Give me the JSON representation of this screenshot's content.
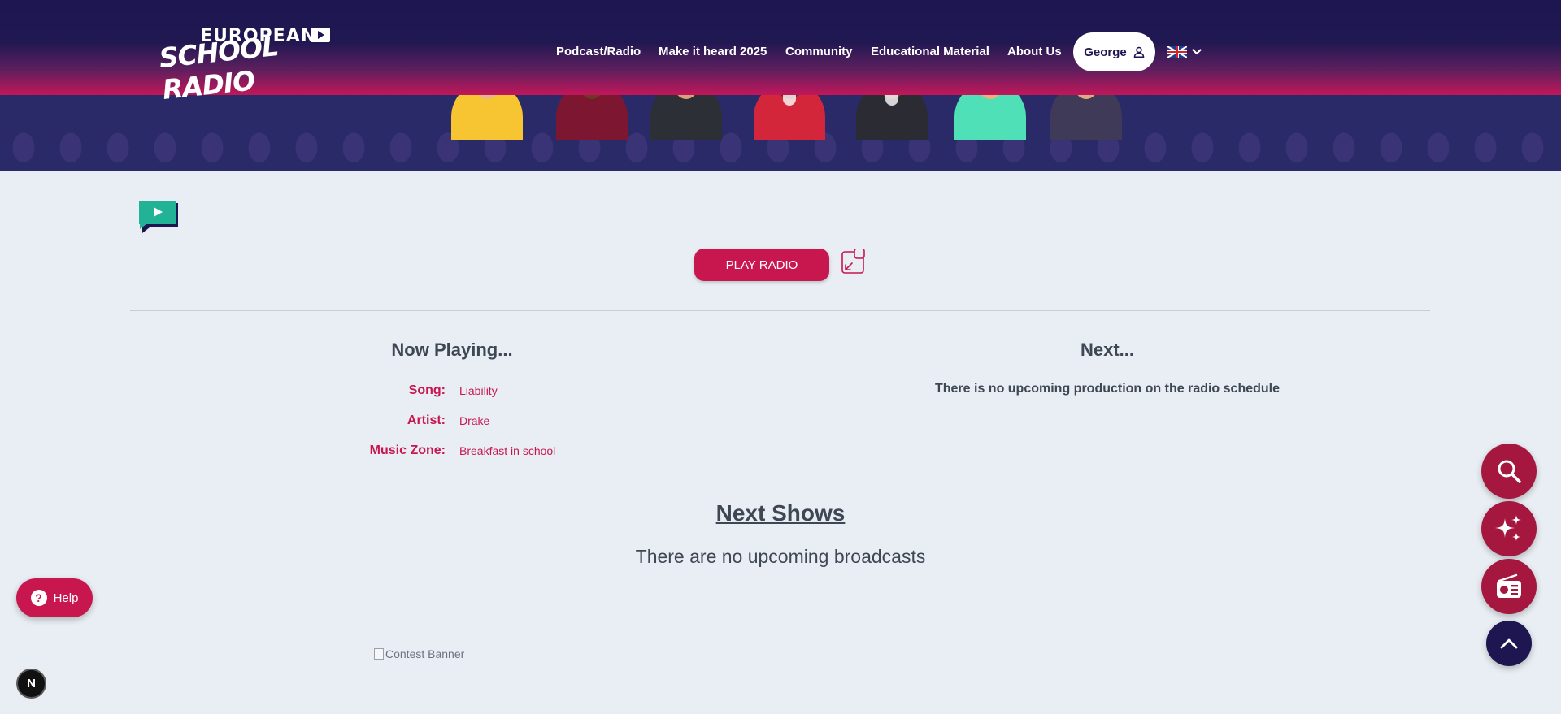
{
  "brand": {
    "logo_line1": "EUROPEAN",
    "logo_line2": "SCHOOL RADIO"
  },
  "nav": {
    "items": [
      {
        "label": "Podcast/Radio"
      },
      {
        "label": "Make it heard 2025"
      },
      {
        "label": "Community"
      },
      {
        "label": "Educational Material"
      },
      {
        "label": "About Us"
      }
    ],
    "user_label": "George",
    "language": "English (UK)"
  },
  "player": {
    "play_label": "PLAY RADIO"
  },
  "now_playing": {
    "heading": "Now Playing...",
    "rows": [
      {
        "label": "Song:",
        "value": "Liability"
      },
      {
        "label": "Artist:",
        "value": "Drake"
      },
      {
        "label": "Music Zone:",
        "value": "Breakfast in school"
      }
    ]
  },
  "next": {
    "heading": "Next...",
    "message": "There is no upcoming production on the radio schedule"
  },
  "shows": {
    "heading": "Next Shows",
    "message": "There are no upcoming broadcasts"
  },
  "banner": {
    "alt": "Contest Banner"
  },
  "help": {
    "label": "Help"
  },
  "dev_badge": {
    "letter": "N"
  },
  "colors": {
    "accent": "#c8164f",
    "navy": "#1d1650",
    "fab": "#a5173e",
    "background": "#e8eef3",
    "teal": "#22b396"
  },
  "fabs": [
    {
      "icon": "search-icon"
    },
    {
      "icon": "sparkles-icon"
    },
    {
      "icon": "radio-icon"
    },
    {
      "icon": "chevron-up-icon"
    }
  ]
}
